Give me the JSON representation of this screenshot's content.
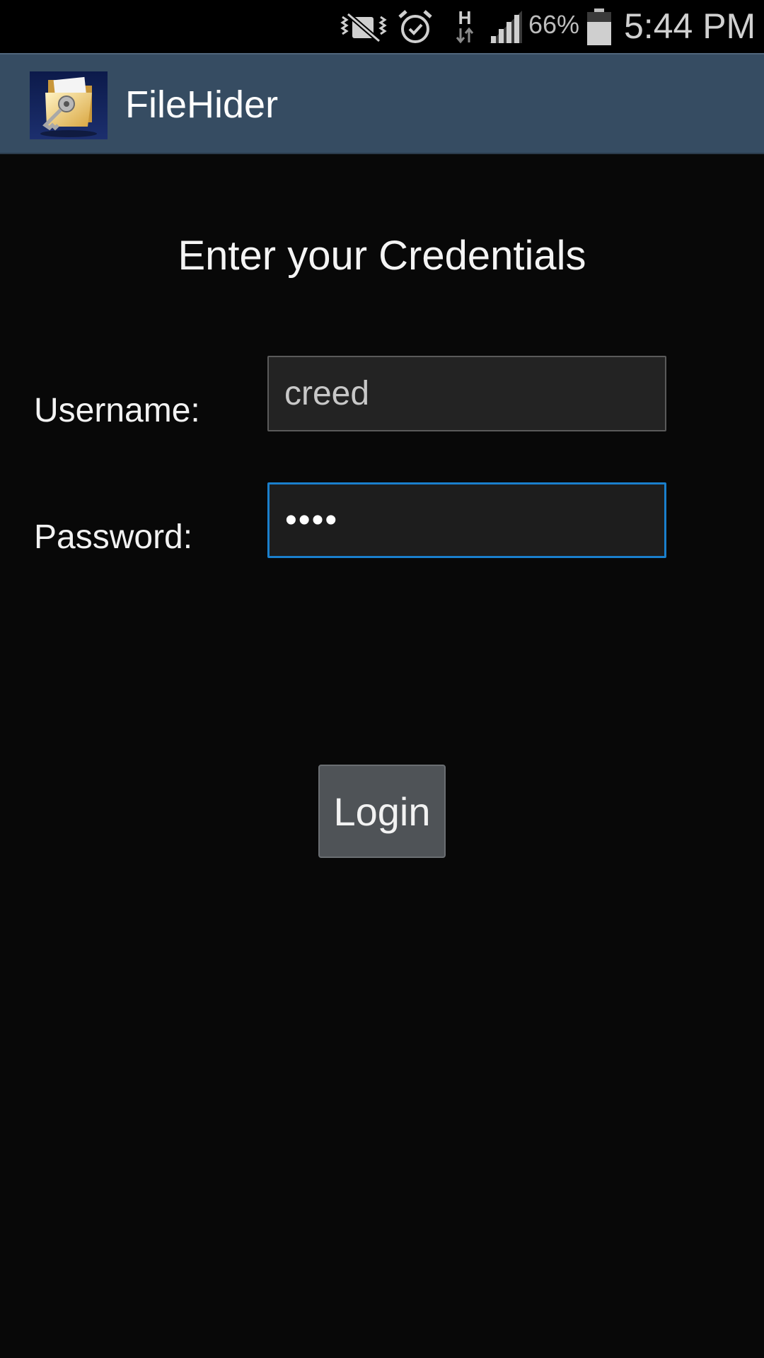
{
  "status_bar": {
    "battery_percent": "66%",
    "time": "5:44 PM",
    "network_type": "H",
    "icons": [
      "vibrate-mute-icon",
      "alarm-icon",
      "data-h-icon",
      "signal-icon",
      "battery-icon"
    ]
  },
  "app_bar": {
    "title": "FileHider",
    "icon": "app-folder-key-icon",
    "background_color": "#364c62"
  },
  "login_form": {
    "heading": "Enter your Credentials",
    "username_label": "Username:",
    "username_value": "creed",
    "password_label": "Password:",
    "password_value": "••••",
    "focused_field": "password",
    "focus_color": "#1a7fcc",
    "login_label": "Login"
  }
}
